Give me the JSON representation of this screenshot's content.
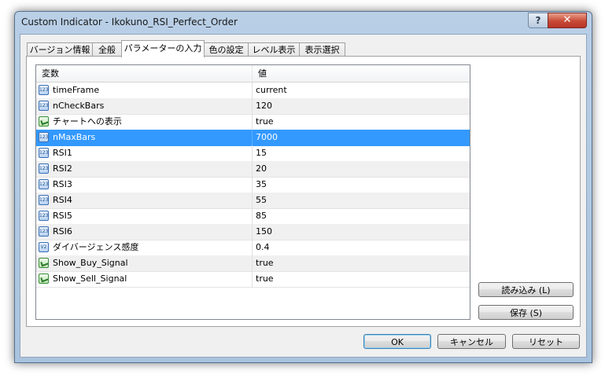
{
  "window": {
    "title": "Custom Indicator - Ikokuno_RSI_Perfect_Order",
    "help_label": "?",
    "close_label": "✕"
  },
  "tabs": [
    {
      "label": "バージョン情報"
    },
    {
      "label": "全般"
    },
    {
      "label": "パラメーターの入力"
    },
    {
      "label": "色の設定"
    },
    {
      "label": "レベル表示"
    },
    {
      "label": "表示選択"
    }
  ],
  "active_tab": "パラメーターの入力",
  "grid": {
    "headers": {
      "variable": "変数",
      "value": "値"
    },
    "rows": [
      {
        "icon": "int-icon",
        "name": "timeFrame",
        "value": "current"
      },
      {
        "icon": "int-icon",
        "name": "nCheckBars",
        "value": "120"
      },
      {
        "icon": "bool-icon",
        "name": "チャートへの表示",
        "value": "true"
      },
      {
        "icon": "int-icon",
        "name": "nMaxBars",
        "value": "7000"
      },
      {
        "icon": "int-icon",
        "name": "RSI1",
        "value": "15"
      },
      {
        "icon": "int-icon",
        "name": "RSI2",
        "value": "20"
      },
      {
        "icon": "int-icon",
        "name": "RSI3",
        "value": "35"
      },
      {
        "icon": "int-icon",
        "name": "RSI4",
        "value": "55"
      },
      {
        "icon": "int-icon",
        "name": "RSI5",
        "value": "85"
      },
      {
        "icon": "int-icon",
        "name": "RSI6",
        "value": "150"
      },
      {
        "icon": "double-icon",
        "name": "ダイバージェンス感度",
        "value": "0.4"
      },
      {
        "icon": "bool-icon",
        "name": "Show_Buy_Signal",
        "value": "true"
      },
      {
        "icon": "bool-icon",
        "name": "Show_Sell_Signal",
        "value": "true"
      }
    ],
    "selected_row": "nMaxBars"
  },
  "side_buttons": {
    "load": "読み込み (L)",
    "save": "保存 (S)"
  },
  "footer_buttons": {
    "ok": "OK",
    "cancel": "キャンセル",
    "reset": "リセット"
  },
  "colors": {
    "selection": "#3399ff",
    "titlebar": "#b9cfe6",
    "close_button": "#c74a35"
  }
}
